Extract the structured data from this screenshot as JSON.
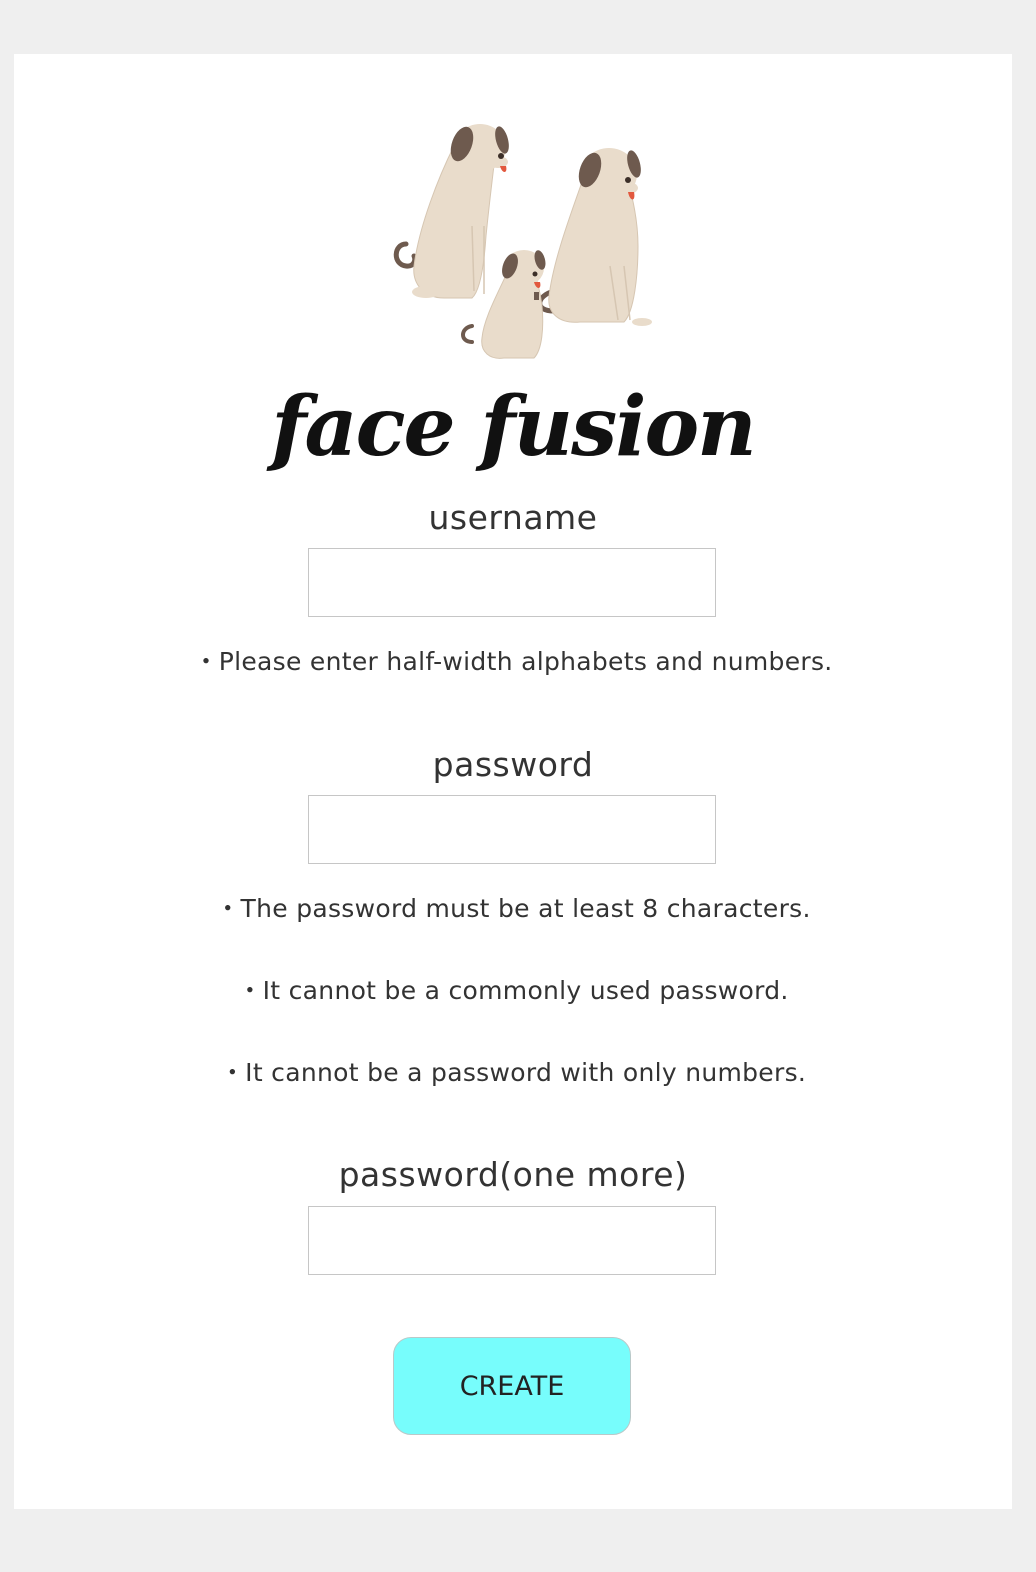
{
  "brand": {
    "name": "face fusion",
    "logo_icon": "three-dogs-illustration"
  },
  "form": {
    "username": {
      "label": "username",
      "value": "",
      "placeholder": "",
      "hint": "・Please enter half-width alphabets and numbers."
    },
    "password": {
      "label": "password",
      "value": "",
      "placeholder": "",
      "hints": [
        "・The password must be at least 8 characters.",
        "・It cannot be a commonly used password.",
        "・It cannot be a password with only numbers."
      ]
    },
    "password_confirm": {
      "label": "password(one more)",
      "value": "",
      "placeholder": ""
    },
    "submit_label": "CREATE"
  },
  "colors": {
    "page_background": "#efefef",
    "card_background": "#ffffff",
    "button_background": "#77fdfc",
    "dog_fur": "#e9dccb",
    "dog_ears": "#6e5a4e",
    "dog_tongue": "#e2583e"
  }
}
